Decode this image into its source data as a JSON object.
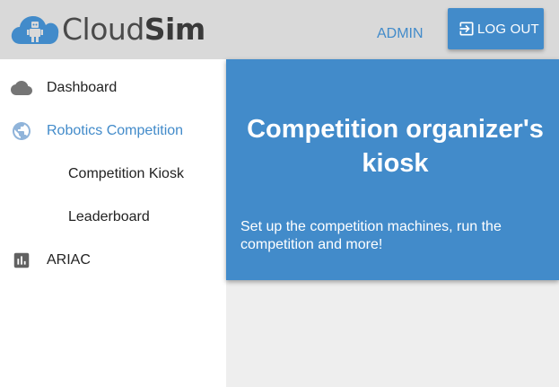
{
  "header": {
    "logo": {
      "part1": "Cloud",
      "part2": "Sim"
    },
    "admin_label": "ADMIN",
    "logout_label": "LOG OUT"
  },
  "sidebar": {
    "items": [
      {
        "label": "Dashboard",
        "icon": "cloud-icon",
        "active": false
      },
      {
        "label": "Robotics Competition",
        "icon": "globe-icon",
        "active": true
      },
      {
        "label": "Competition Kiosk",
        "icon": "",
        "active": false
      },
      {
        "label": "Leaderboard",
        "icon": "",
        "active": false
      },
      {
        "label": "ARIAC",
        "icon": "bar-chart-icon",
        "active": false
      }
    ]
  },
  "hero": {
    "title": "Competition organizer's kiosk",
    "subtitle": "Set up the competition machines, run the competition and more!"
  },
  "colors": {
    "accent": "#428bca",
    "topbar": "#d9d9d9",
    "content_bg": "#eeeeee"
  }
}
